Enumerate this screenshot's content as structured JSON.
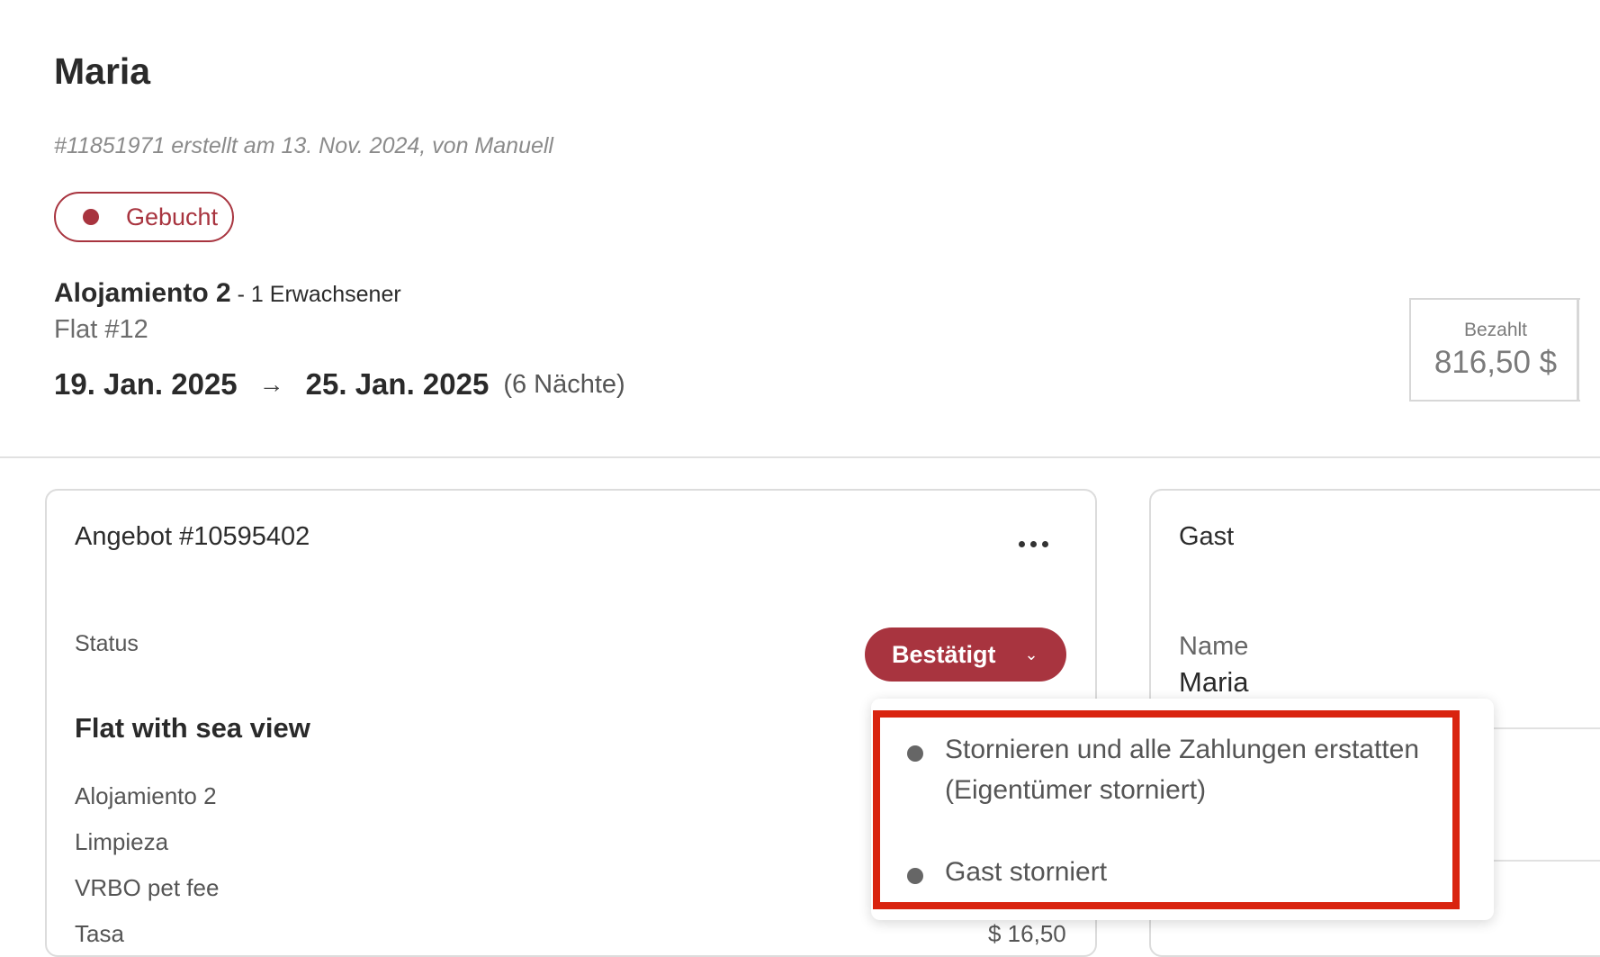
{
  "header": {
    "title": "Maria",
    "meta": "#11851971 erstellt am 13. Nov. 2024, von Manuell",
    "status_badge": "Gebucht"
  },
  "booking": {
    "unit_name": "Alojamiento 2",
    "guests": " - 1 Erwachsener",
    "flat": "Flat #12",
    "check_in": "19. Jan. 2025",
    "arrow": "→",
    "check_out": "25. Jan. 2025",
    "nights": "(6 Nächte)"
  },
  "payment": {
    "label": "Bezahlt",
    "value": "816,50 $"
  },
  "offer": {
    "title": "Angebot #10595402",
    "status_label": "Status",
    "status_button": "Bestätigt",
    "section_title": "Flat with sea view",
    "line_items": [
      "Alojamiento 2",
      "Limpieza",
      "VRBO pet fee",
      "Tasa"
    ],
    "cut_price": "$ 16,50"
  },
  "guest": {
    "title": "Gast",
    "name_label": "Name",
    "name_value": "Maria"
  },
  "status_menu": {
    "items": [
      "Stornieren und alle Zahlungen erstatten (Eigentümer storniert)",
      "Gast storniert"
    ]
  },
  "colors": {
    "accent": "#a8343f",
    "highlight": "#d9240f"
  }
}
